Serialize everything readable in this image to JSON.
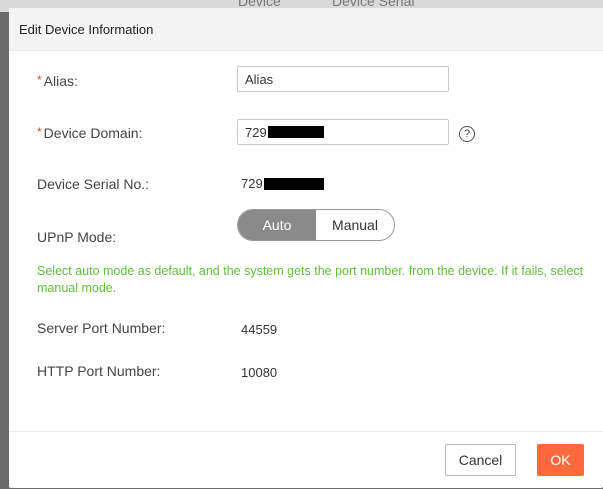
{
  "background": {
    "col1": "Device",
    "col2": "Device Serial"
  },
  "dialog": {
    "title": "Edit Device Information",
    "alias": {
      "required_mark": "*",
      "label": "Alias:",
      "value": "Alias"
    },
    "domain": {
      "required_mark": "*",
      "label": "Device Domain:",
      "value_prefix": "729",
      "help_glyph": "?"
    },
    "serial": {
      "label": "Device Serial No.:",
      "value_prefix": "729"
    },
    "upnp": {
      "label": "UPnP Mode:",
      "options": [
        "Auto",
        "Manual"
      ],
      "selected": "Auto"
    },
    "hint": "Select auto mode as default, and the system gets the port number. from the device. If it fails, select manual mode.",
    "server_port": {
      "label": "Server Port Number:",
      "value": "44559"
    },
    "http_port": {
      "label": "HTTP Port Number:",
      "value": "10080"
    },
    "buttons": {
      "cancel": "Cancel",
      "ok": "OK"
    }
  },
  "colors": {
    "ok_button": "#ff6a3d",
    "hint_text": "#5fbf3a",
    "required_mark": "#e0443b",
    "toggle_active": "#8a8a8a"
  }
}
